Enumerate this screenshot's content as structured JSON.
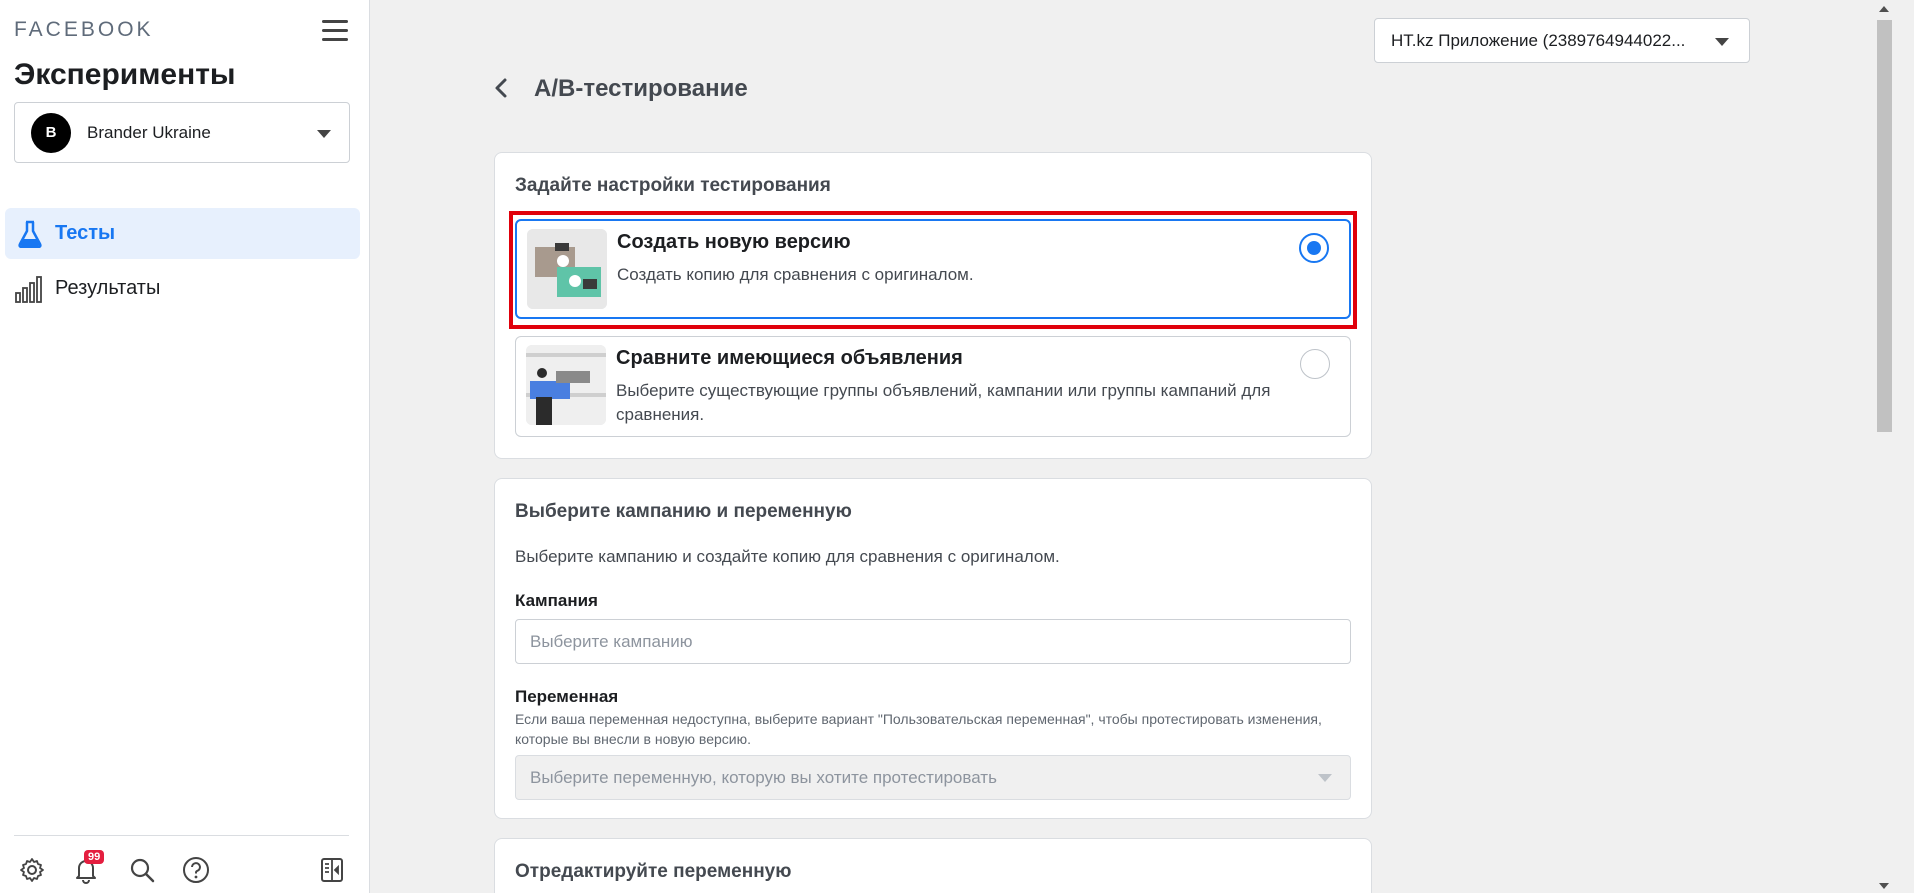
{
  "sidebar": {
    "brand": "FACEBOOK",
    "title": "Эксперименты",
    "account": {
      "avatar_letter": "B",
      "name": "Brander Ukraine"
    },
    "nav": [
      {
        "label": "Тесты",
        "icon": "flask-icon",
        "active": true
      },
      {
        "label": "Результаты",
        "icon": "bar-chart-icon",
        "active": false
      }
    ],
    "bottom_icons": [
      "settings-icon",
      "notifications-icon",
      "search-icon",
      "help-icon",
      "panel-toggle-icon"
    ],
    "notification_count": "99"
  },
  "header": {
    "app_selector": "HT.kz Приложение (2389764944022..."
  },
  "main": {
    "page_title": "A/B-тестирование",
    "settings_card": {
      "title": "Задайте настройки тестирования",
      "options": [
        {
          "title": "Создать новую версию",
          "description": "Создать копию для сравнения с оригиналом.",
          "selected": true
        },
        {
          "title": "Сравните имеющиеся объявления",
          "description": "Выберите существующие группы объявлений, кампании или группы кампаний для сравнения.",
          "selected": false
        }
      ]
    },
    "campaign_card": {
      "title": "Выберите кампанию и переменную",
      "description": "Выберите кампанию и создайте копию для сравнения с оригиналом.",
      "campaign_label": "Кампания",
      "campaign_placeholder": "Выберите кампанию",
      "variable_label": "Переменная",
      "variable_note": "Если ваша переменная недоступна, выберите вариант \"Пользовательская переменная\", чтобы протестировать изменения, которые вы внесли в новую версию.",
      "variable_placeholder": "Выберите переменную, которую вы хотите протестировать"
    },
    "edit_card": {
      "title": "Отредактируйте переменную"
    }
  },
  "colors": {
    "accent": "#1877f2",
    "highlight": "#e0000b",
    "badge": "#e41e3f"
  }
}
